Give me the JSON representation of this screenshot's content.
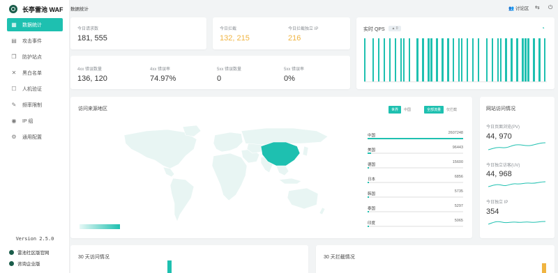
{
  "sidebar": {
    "brand": "长亭雷池 WAF",
    "items": [
      {
        "label": "数据统计",
        "icon": "grid-icon",
        "glyph": "▦",
        "active": true
      },
      {
        "label": "攻击事件",
        "icon": "calendar-icon",
        "glyph": "▤",
        "active": false
      },
      {
        "label": "防护站点",
        "icon": "cube-icon",
        "glyph": "❒",
        "active": false
      },
      {
        "label": "黑白名单",
        "icon": "tools-icon",
        "glyph": "✕",
        "active": false
      },
      {
        "label": "人机验证",
        "icon": "robot-icon",
        "glyph": "☐",
        "active": false
      },
      {
        "label": "频率限制",
        "icon": "wrench-icon",
        "glyph": "✎",
        "active": false
      },
      {
        "label": "IP 组",
        "icon": "location-icon",
        "glyph": "◉",
        "active": false
      },
      {
        "label": "通用配置",
        "icon": "settings-icon",
        "glyph": "⚙",
        "active": false
      }
    ],
    "version": "Version 2.5.0",
    "community_link": "雷池社区版官网",
    "enterprise_link": "咨询企业版"
  },
  "topbar": {
    "title": "数据统计",
    "user": "讨论区"
  },
  "stats_main": {
    "total_requests_label": "今日请求数",
    "total_requests": "181, 555",
    "blocked_label": "今日拦截",
    "blocked": "132, 215",
    "blocked_ip_label": "今日拦截独立 IP",
    "blocked_ip": "216"
  },
  "stats_errors": [
    {
      "label": "4xx 错误数量",
      "value": "136, 120"
    },
    {
      "label": "4xx 错误率",
      "value": "74.97%"
    },
    {
      "label": "5xx 错误数量",
      "value": "0"
    },
    {
      "label": "5xx 错误率",
      "value": "0%"
    }
  ],
  "qps": {
    "title": "实时 QPS",
    "badge": "0",
    "bars": [
      1,
      0,
      0,
      1,
      0,
      1,
      0,
      1,
      0,
      1,
      0,
      1,
      0,
      1,
      1,
      0,
      1,
      0,
      0,
      1,
      0,
      1,
      0,
      1,
      1,
      0,
      1,
      0,
      1,
      0,
      1,
      0,
      1,
      0,
      1,
      1,
      0,
      1,
      0,
      1,
      0,
      1,
      0,
      0,
      1,
      0,
      1,
      0,
      1,
      1,
      0,
      1,
      0,
      1,
      0,
      1,
      0,
      1,
      1,
      1,
      0,
      1,
      0,
      1,
      0,
      1
    ],
    "color": "#1ec0b0"
  },
  "map": {
    "title": "访问来源地区",
    "scope_tabs": [
      "世界",
      "中国"
    ],
    "mode_tabs": [
      "全部流量",
      "仅拦截"
    ],
    "countries": [
      {
        "name": "中国",
        "value": "2607248",
        "pct": 100
      },
      {
        "name": "美国",
        "value": "96443",
        "pct": 4
      },
      {
        "name": "德国",
        "value": "15600",
        "pct": 1
      },
      {
        "name": "日本",
        "value": "6856",
        "pct": 0.5
      },
      {
        "name": "韩国",
        "value": "5735",
        "pct": 0.4
      },
      {
        "name": "泰国",
        "value": "5297",
        "pct": 0.4
      },
      {
        "name": "印度",
        "value": "5065",
        "pct": 0.3
      }
    ]
  },
  "site_visits": {
    "title": "网站访问情况",
    "pv_label": "今日页面浏览(PV)",
    "pv": "44, 970",
    "uv_label": "今日独立访客(UV)",
    "uv": "44, 968",
    "ip_label": "今日独立 IP",
    "ip": "354"
  },
  "bottom": {
    "visits_title": "30 天访问情况",
    "blocks_title": "30 天拦截情况"
  },
  "colors": {
    "accent": "#1ec0b0",
    "orange": "#f0b441"
  }
}
